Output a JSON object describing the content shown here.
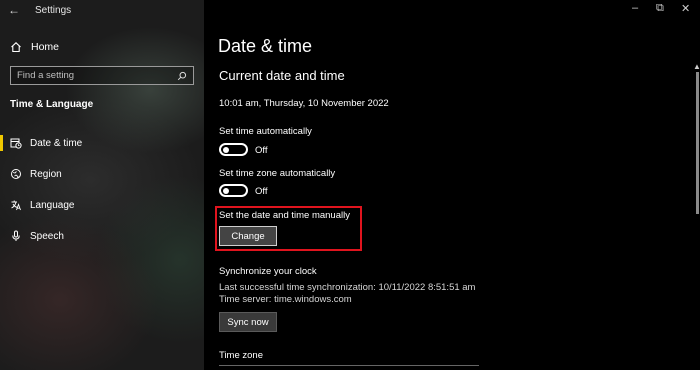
{
  "window": {
    "title": "Settings",
    "back_glyph": "←",
    "minimize_glyph": "–",
    "maximize_glyph": "⧉",
    "close_glyph": "✕"
  },
  "nav": {
    "home_label": "Home",
    "search_placeholder": "Find a setting",
    "section_title": "Time & Language",
    "items": [
      {
        "label": "Date & time",
        "icon": "calendar-clock-icon",
        "selected": true
      },
      {
        "label": "Region",
        "icon": "globe-icon",
        "selected": false
      },
      {
        "label": "Language",
        "icon": "language-icon",
        "selected": false
      },
      {
        "label": "Speech",
        "icon": "microphone-icon",
        "selected": false
      }
    ],
    "accent_color": "#f0c800"
  },
  "main": {
    "page_title": "Date & time",
    "section_title": "Current date and time",
    "current_datetime": "10:01 am, Thursday, 10 November 2022",
    "set_time_auto": {
      "label": "Set time automatically",
      "state": "Off"
    },
    "set_tz_auto": {
      "label": "Set time zone automatically",
      "state": "Off"
    },
    "manual": {
      "label": "Set the date and time manually",
      "button": "Change"
    },
    "sync": {
      "title": "Synchronize your clock",
      "last_sync": "Last successful time synchronization: 10/11/2022 8:51:51 am",
      "time_server": "Time server: time.windows.com",
      "button": "Sync now"
    },
    "time_zone_title": "Time zone",
    "highlight_color": "#e0141e"
  }
}
